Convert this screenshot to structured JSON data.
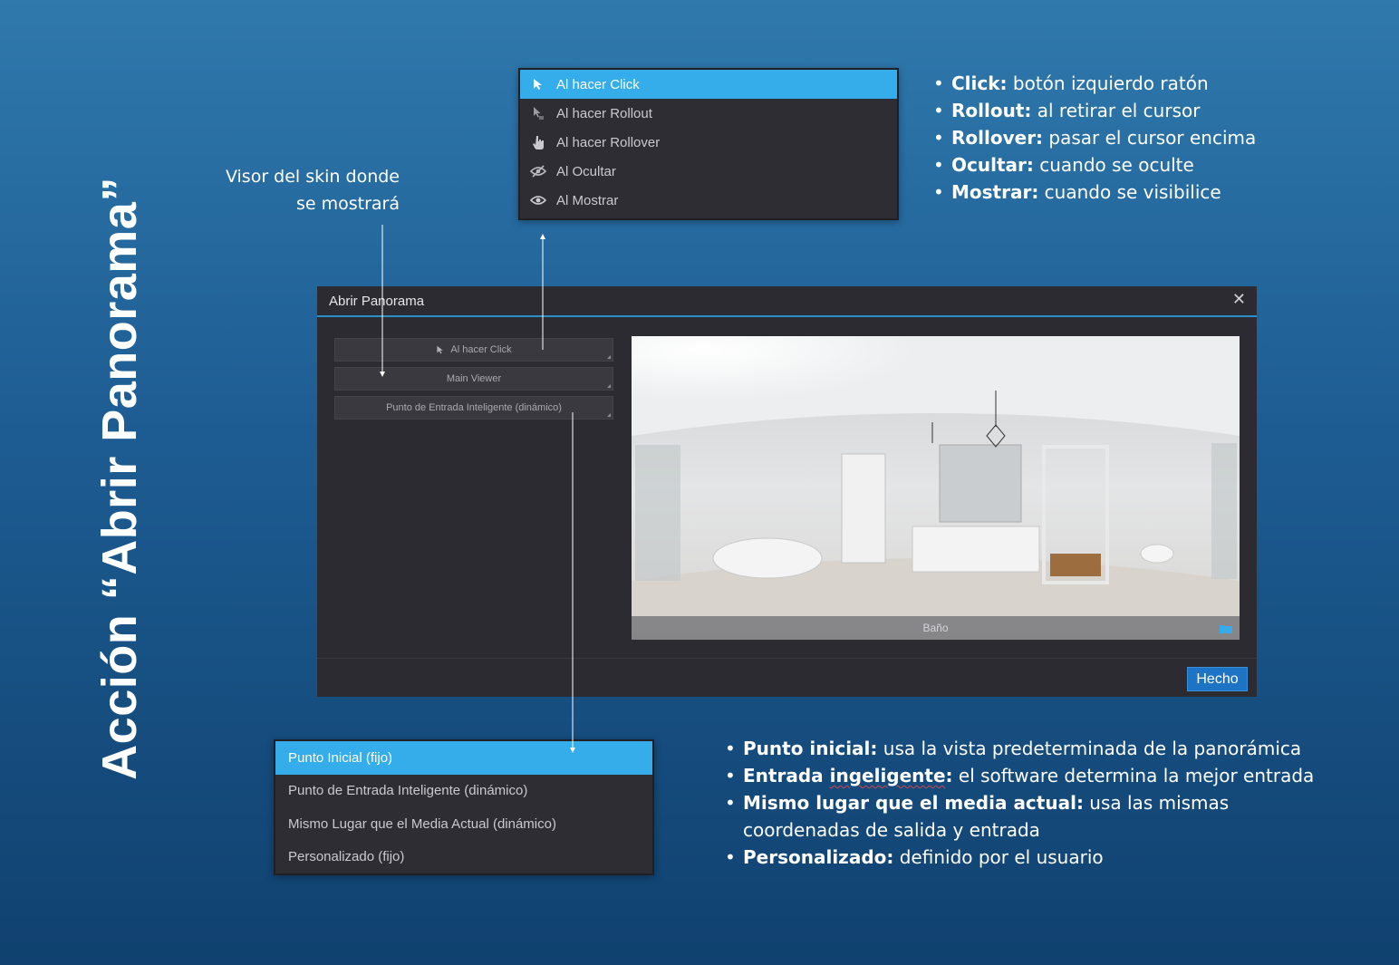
{
  "title": "Acción “Abrir Panorama”",
  "viewer_note": [
    "Visor del skin donde",
    "se mostrará"
  ],
  "events_menu": {
    "items": [
      {
        "label": "Al hacer Click",
        "icon": "cursor-arrow-icon",
        "selected": true
      },
      {
        "label": "Al hacer Rollout",
        "icon": "cursor-rollout-icon",
        "selected": false
      },
      {
        "label": "Al hacer Rollover",
        "icon": "hand-pointer-icon",
        "selected": false
      },
      {
        "label": "Al Ocultar",
        "icon": "eye-slash-icon",
        "selected": false
      },
      {
        "label": "Al Mostrar",
        "icon": "eye-icon",
        "selected": false
      }
    ]
  },
  "events_bullets": [
    {
      "term": "Click:",
      "desc": " botón izquierdo ratón"
    },
    {
      "term": "Rollout:",
      "desc": " al retirar el cursor"
    },
    {
      "term": "Rollover:",
      "desc": " pasar el cursor encima"
    },
    {
      "term": "Ocultar:",
      "desc": " cuando se oculte"
    },
    {
      "term": "Mostrar:",
      "desc": " cuando se visibilice"
    }
  ],
  "dialog": {
    "title": "Abrir Panorama",
    "close_symbol": "✕",
    "event_dropdown": "Al hacer Click",
    "viewer_dropdown": "Main Viewer",
    "entry_dropdown": "Punto de Entrada Inteligente (dinámico)",
    "panorama_caption": "Baño",
    "done_label": "Hecho"
  },
  "entry_menu": {
    "items": [
      {
        "label": "Punto Inicial (fijo)",
        "selected": true
      },
      {
        "label": "Punto de Entrada Inteligente (dinámico)",
        "selected": false
      },
      {
        "label": "Mismo Lugar que el Media Actual (dinámico)",
        "selected": false
      },
      {
        "label": "Personalizado (fijo)",
        "selected": false
      }
    ]
  },
  "entry_bullets": [
    {
      "term": "Punto inicial:",
      "desc": " usa la vista predeterminada de la panorámica"
    },
    {
      "term_pre": "Entrada ",
      "term_err": "ingeligente",
      "term_post": ":",
      "desc": " el software determina la mejor entrada"
    },
    {
      "term": "Mismo lugar que el media actual:",
      "desc": " usa las mismas coordenadas de salida y entrada"
    },
    {
      "term": "Personalizado:",
      "desc": " definido por el usuario"
    }
  ],
  "colors": {
    "accent": "#34adea",
    "button": "#1e74c4",
    "dialog_bg": "#2c2b31",
    "background_top": "#2f79ad",
    "background_bottom": "#10416f"
  }
}
